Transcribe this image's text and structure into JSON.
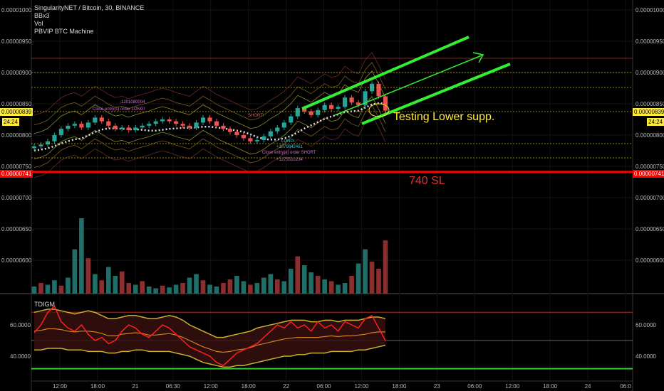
{
  "legend": {
    "title": "SingularityNET / Bitcoin, 30, BINANCE",
    "lines": [
      "BBx3",
      "Vol",
      "PBVIP BTC Machine"
    ]
  },
  "indicator_title": "TDIGM",
  "price_tags": {
    "current": "0.00000839",
    "countdown": "24:24",
    "stop": "0.00000741"
  },
  "annotations": {
    "support": "Testing Lower supp.",
    "sl": "740 SL",
    "trade_labels": [
      "-1201080004",
      "Close entry(s) order LONG!",
      "SHORT!",
      "LONG!",
      "+1879842461",
      "Close entry(s) order SHORT",
      "+1275510234"
    ]
  },
  "colors": {
    "background": "#000000",
    "up": "#26a69a",
    "down": "#ef5350",
    "trendline": "#33ee33",
    "highlight": "#ffeb3b",
    "sl": "#ff0000"
  },
  "chart_data": {
    "type": "candlestick",
    "symbol": "SingularityNET / Bitcoin, 30, BINANCE",
    "price_axis": [
      "0.00001000",
      "0.00000950",
      "0.00000900",
      "0.00000850",
      "0.00000800",
      "0.00000750",
      "0.00000700",
      "0.00000650",
      "0.00000600"
    ],
    "ylim": [
      5.6e-06,
      1.01e-05
    ],
    "time_axis": [
      "12:00",
      "18:00",
      "21",
      "06:30",
      "12:00",
      "18:00",
      "22",
      "06:00",
      "12:00",
      "18:00",
      "23",
      "06:00",
      "12:00",
      "18:00",
      "24",
      "06:0"
    ],
    "current_price": 8.39e-06,
    "stop_loss": 7.41e-06,
    "close_series": [
      7.82e-06,
      7.85e-06,
      7.9e-06,
      8e-06,
      8.1e-06,
      8.15e-06,
      8.18e-06,
      8.12e-06,
      8.2e-06,
      8.28e-06,
      8.22e-06,
      8.15e-06,
      8.1e-06,
      8.12e-06,
      8.08e-06,
      8.12e-06,
      8.15e-06,
      8.18e-06,
      8.22e-06,
      8.25e-06,
      8.22e-06,
      8.18e-06,
      8.15e-06,
      8.12e-06,
      8.2e-06,
      8.28e-06,
      8.22e-06,
      8.15e-06,
      8.1e-06,
      8.05e-06,
      8e-06,
      7.95e-06,
      7.9e-06,
      7.92e-06,
      7.98e-06,
      8.06e-06,
      8.12e-06,
      8.2e-06,
      8.3e-06,
      8.43e-06,
      8.38e-06,
      8.32e-06,
      8.4e-06,
      8.48e-06,
      8.42e-06,
      8.45e-06,
      8.6e-06,
      8.52e-06,
      8.48e-06,
      8.7e-06,
      8.82e-06,
      8.62e-06,
      8.39e-06
    ],
    "volume": {
      "values": [
        8,
        12,
        10,
        15,
        9,
        18,
        50,
        85,
        40,
        22,
        15,
        30,
        20,
        25,
        12,
        10,
        14,
        8,
        6,
        9,
        7,
        10,
        12,
        18,
        22,
        15,
        10,
        8,
        12,
        16,
        20,
        14,
        10,
        12,
        18,
        22,
        16,
        14,
        28,
        42,
        32,
        24,
        20,
        16,
        14,
        10,
        12,
        20,
        34,
        50,
        36,
        28,
        60
      ],
      "up": [
        true,
        false,
        true,
        true,
        false,
        true,
        true,
        true,
        false,
        true,
        false,
        true,
        true,
        false,
        false,
        true,
        false,
        true,
        true,
        false,
        true,
        true,
        false,
        true,
        true,
        false,
        true,
        true,
        false,
        false,
        true,
        true,
        false,
        true,
        true,
        true,
        false,
        true,
        true,
        false,
        true,
        true,
        false,
        true,
        false,
        true,
        true,
        false,
        true,
        true,
        false,
        false,
        false
      ]
    },
    "indicator": {
      "name": "TDIGM",
      "axis": [
        "60.0000",
        "40.0000"
      ],
      "ylim": [
        28,
        78
      ],
      "levels": [
        68,
        50,
        32
      ],
      "rsi": [
        55,
        60,
        68,
        72,
        62,
        58,
        56,
        60,
        54,
        50,
        52,
        48,
        50,
        56,
        60,
        58,
        54,
        52,
        56,
        60,
        58,
        54,
        50,
        46,
        44,
        42,
        40,
        36,
        34,
        38,
        42,
        44,
        46,
        48,
        52,
        56,
        60,
        58,
        62,
        58,
        60,
        56,
        62,
        58,
        60,
        56,
        62,
        60,
        58,
        64,
        66,
        58,
        50
      ],
      "upper_band": [
        68,
        69,
        70,
        70,
        69,
        68,
        67,
        68,
        69,
        68,
        66,
        64,
        64,
        65,
        66,
        66,
        65,
        64,
        64,
        65,
        66,
        65,
        63,
        60,
        58,
        56,
        54,
        52,
        52,
        53,
        54,
        55,
        56,
        58,
        59,
        60,
        61,
        62,
        63,
        63,
        63,
        62,
        62,
        63,
        63,
        62,
        63,
        63,
        63,
        64,
        65,
        65,
        64
      ],
      "lower_band": [
        44,
        44,
        45,
        45,
        45,
        44,
        44,
        44,
        43,
        43,
        43,
        42,
        42,
        43,
        43,
        44,
        44,
        43,
        43,
        43,
        43,
        42,
        41,
        40,
        38,
        36,
        35,
        34,
        33,
        33,
        34,
        34,
        35,
        36,
        37,
        38,
        39,
        40,
        40,
        41,
        41,
        42,
        42,
        42,
        43,
        43,
        43,
        43,
        44,
        44,
        45,
        46,
        47
      ]
    }
  }
}
